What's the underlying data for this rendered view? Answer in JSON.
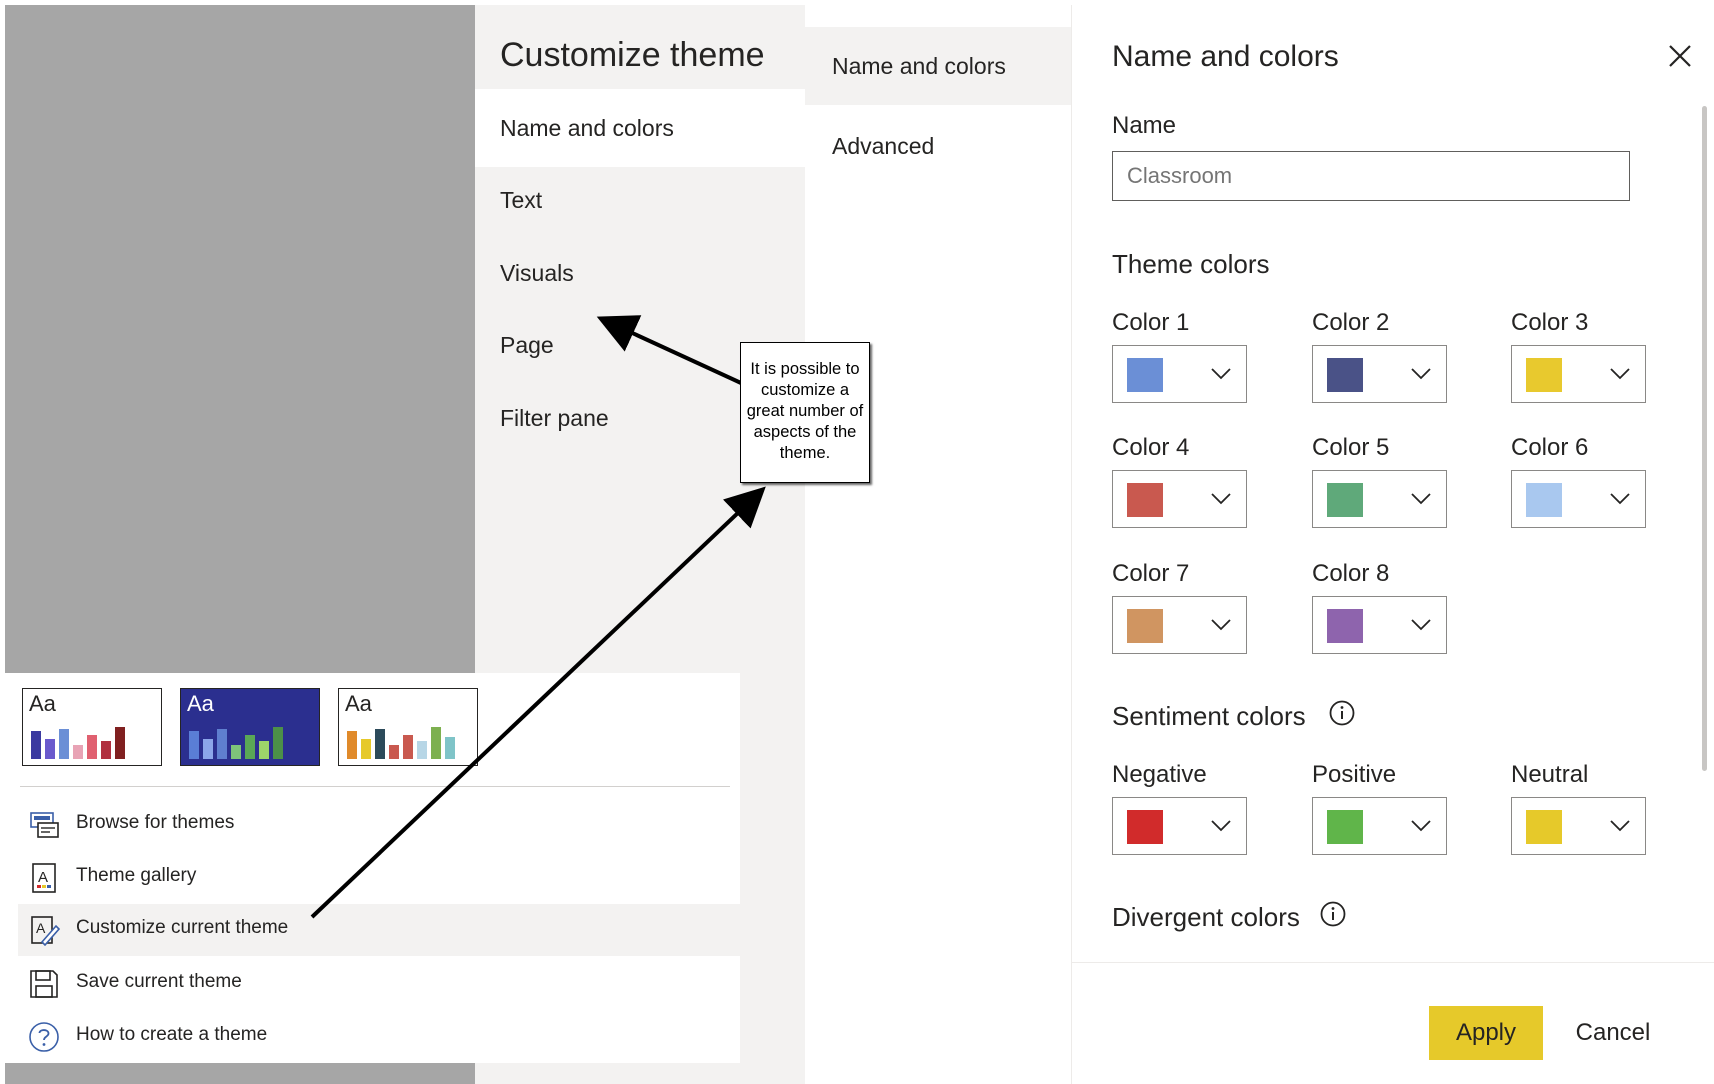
{
  "customize_theme": {
    "title": "Customize theme",
    "nav_items": [
      "Name and colors",
      "Text",
      "Visuals",
      "Page",
      "Filter pane"
    ],
    "selected_index": 0
  },
  "subnav": {
    "items": [
      "Name and colors",
      "Advanced"
    ],
    "selected_index": 0
  },
  "panel": {
    "title": "Name and colors",
    "name_label": "Name",
    "name_placeholder": "Classroom",
    "theme_colors_title": "Theme colors",
    "theme_colors": [
      {
        "label": "Color 1",
        "color": "#6b8fd6"
      },
      {
        "label": "Color 2",
        "color": "#4a5287"
      },
      {
        "label": "Color 3",
        "color": "#e8c92e"
      },
      {
        "label": "Color 4",
        "color": "#c9594f"
      },
      {
        "label": "Color 5",
        "color": "#5fa97a"
      },
      {
        "label": "Color 6",
        "color": "#a9c8ef"
      },
      {
        "label": "Color 7",
        "color": "#d09561"
      },
      {
        "label": "Color 8",
        "color": "#8e64ad"
      }
    ],
    "sentiment_title": "Sentiment colors",
    "sentiment_colors": [
      {
        "label": "Negative",
        "color": "#d12b2b"
      },
      {
        "label": "Positive",
        "color": "#60b54a"
      },
      {
        "label": "Neutral",
        "color": "#e6c92a"
      }
    ],
    "divergent_title": "Divergent colors",
    "apply_label": "Apply",
    "cancel_label": "Cancel",
    "close_icon": "close-icon",
    "info_icon": "info-icon"
  },
  "themes_menu": {
    "thumbnail_text": "Aa",
    "thumbnails": [
      {
        "bg": "#ffffff",
        "text": "#252423",
        "bars": [
          "#3b3aa0",
          "#6a5acd",
          "#6b8fd6",
          "#e8a3b5",
          "#e06070",
          "#b03040",
          "#802020"
        ]
      },
      {
        "bg": "#2b2f8f",
        "text": "#ffffff",
        "bars": [
          "#5a7ed6",
          "#8ca6ea",
          "#5f7fcf",
          "#7ec47a",
          "#5aa856",
          "#9ed46a",
          "#4c9048"
        ]
      },
      {
        "bg": "#ffffff",
        "text": "#252423",
        "bars": [
          "#e08a2a",
          "#e6c92a",
          "#2c4a5a",
          "#c9594f",
          "#c9594f",
          "#b7d6e6",
          "#7db050",
          "#7fc4c8"
        ]
      }
    ],
    "items": [
      {
        "label": "Browse for themes",
        "icon": "browse-themes-icon"
      },
      {
        "label": "Theme gallery",
        "icon": "theme-gallery-icon"
      },
      {
        "label": "Customize current theme",
        "icon": "customize-theme-icon"
      },
      {
        "label": "Save current theme",
        "icon": "save-icon"
      },
      {
        "label": "How to create a theme",
        "icon": "help-icon"
      }
    ],
    "highlight_index": 2
  },
  "callout": {
    "text": "It is possible to customize a great number of aspects of the theme."
  }
}
